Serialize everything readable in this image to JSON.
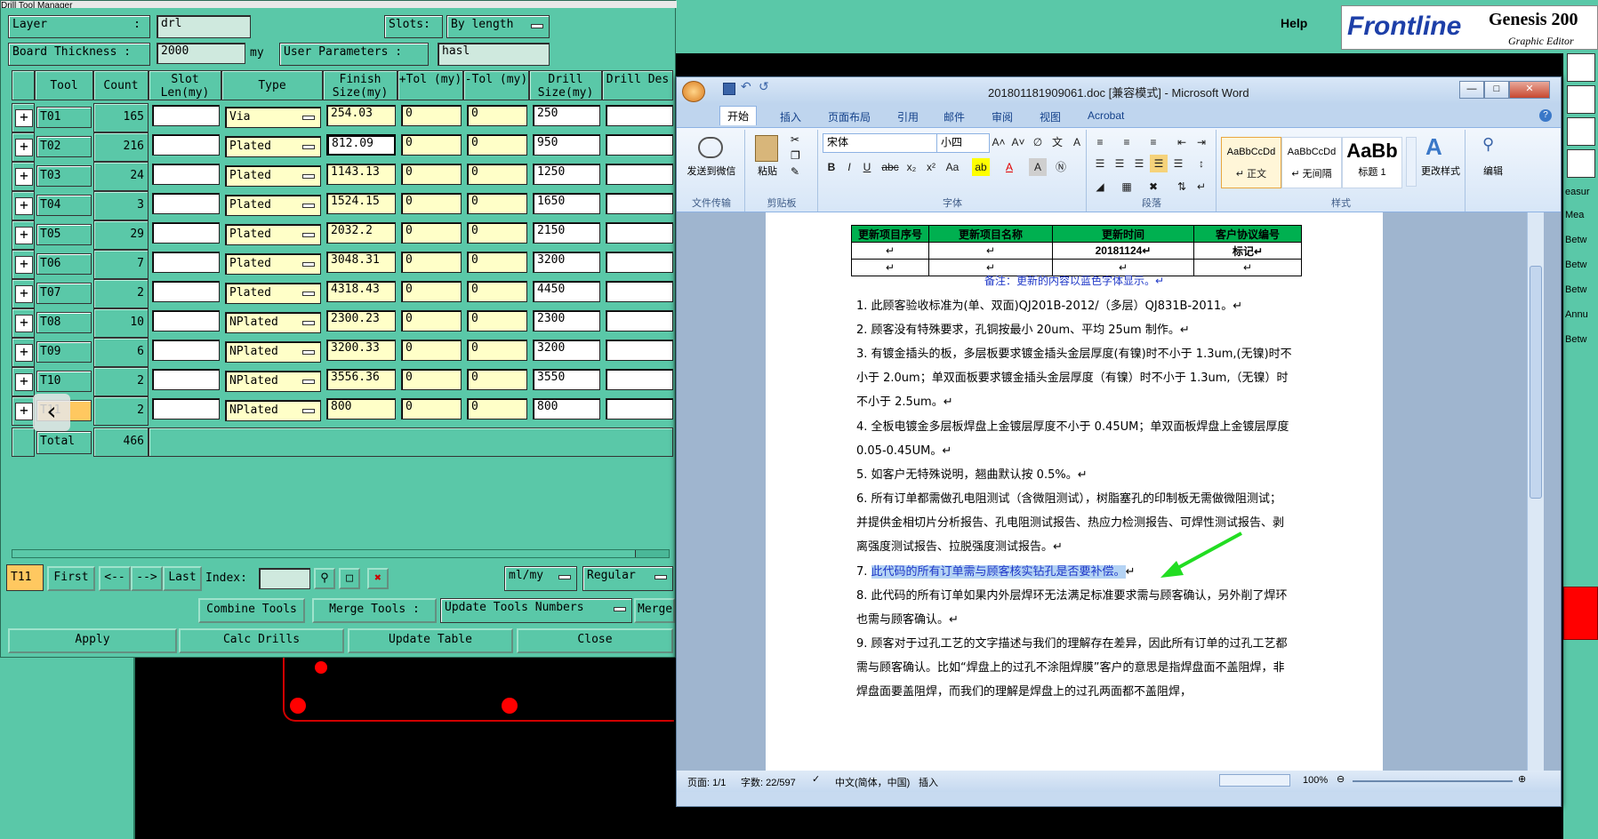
{
  "genesis": {
    "help": "Help",
    "logo_brand": "Frontline",
    "logo_product": "Genesis 200",
    "logo_sub": "Graphic Editor",
    "right_labels": [
      "easur",
      "Mea",
      "Betw",
      "Betw",
      "Betw",
      "Annu",
      "Betw"
    ]
  },
  "drill": {
    "title": "Drill Tool Manager",
    "layer_label": "Layer",
    "layer_sep": ":",
    "layer_value": "drl",
    "slots_label": "Slots:",
    "slots_value": "By length",
    "thickness_label": "Board Thickness :",
    "thickness_value": "2000",
    "thickness_unit": "my",
    "user_params_label": "User Parameters :",
    "user_params_value": "hasl",
    "headers": {
      "tool": "Tool",
      "count": "Count",
      "slot": "Slot Len(my)",
      "type": "Type",
      "finish": "Finish Size(my)",
      "ptol": "+Tol (my)",
      "ntol": "-Tol (my)",
      "drill": "Drill Size(my)",
      "des": "Drill Des"
    },
    "rows": [
      {
        "tool": "T01",
        "count": "165",
        "type": "Via",
        "finish": "254.03",
        "ptol": "0",
        "ntol": "0",
        "drill": "250"
      },
      {
        "tool": "T02",
        "count": "216",
        "type": "Plated",
        "finish": "812.09",
        "ptol": "0",
        "ntol": "0",
        "drill": "950"
      },
      {
        "tool": "T03",
        "count": "24",
        "type": "Plated",
        "finish": "1143.13",
        "ptol": "0",
        "ntol": "0",
        "drill": "1250"
      },
      {
        "tool": "T04",
        "count": "3",
        "type": "Plated",
        "finish": "1524.15",
        "ptol": "0",
        "ntol": "0",
        "drill": "1650"
      },
      {
        "tool": "T05",
        "count": "29",
        "type": "Plated",
        "finish": "2032.2",
        "ptol": "0",
        "ntol": "0",
        "drill": "2150"
      },
      {
        "tool": "T06",
        "count": "7",
        "type": "Plated",
        "finish": "3048.31",
        "ptol": "0",
        "ntol": "0",
        "drill": "3200"
      },
      {
        "tool": "T07",
        "count": "2",
        "type": "Plated",
        "finish": "4318.43",
        "ptol": "0",
        "ntol": "0",
        "drill": "4450"
      },
      {
        "tool": "T08",
        "count": "10",
        "type": "NPlated",
        "finish": "2300.23",
        "ptol": "0",
        "ntol": "0",
        "drill": "2300"
      },
      {
        "tool": "T09",
        "count": "6",
        "type": "NPlated",
        "finish": "3200.33",
        "ptol": "0",
        "ntol": "0",
        "drill": "3200"
      },
      {
        "tool": "T10",
        "count": "2",
        "type": "NPlated",
        "finish": "3556.36",
        "ptol": "0",
        "ntol": "0",
        "drill": "3550"
      },
      {
        "tool": "T11",
        "count": "2",
        "type": "NPlated",
        "finish": "800",
        "ptol": "0",
        "ntol": "0",
        "drill": "800"
      }
    ],
    "total_label": "Total",
    "total_count": "466",
    "current_tool": "T11",
    "nav": {
      "first": "First",
      "prev": "<--",
      "next": "-->",
      "last": "Last",
      "index_label": "Index:",
      "units": "ml/my",
      "mode": "Regular"
    },
    "actions1": {
      "combine": "Combine Tools",
      "merge": "Merge Tools :",
      "update_numbers": "Update Tools Numbers",
      "merge2": "Merge"
    },
    "actions2": {
      "apply": "Apply",
      "calc": "Calc Drills",
      "update_table": "Update Table",
      "close": "Close"
    }
  },
  "word": {
    "title": "201801181909061.doc [兼容模式] - Microsoft Word",
    "tabs": [
      "开始",
      "插入",
      "页面布局",
      "引用",
      "邮件",
      "审阅",
      "视图",
      "Acrobat"
    ],
    "ribbon": {
      "wechat_send": "发送到微信",
      "file_transfer": "文件传输",
      "paste": "粘贴",
      "clipboard": "剪贴板",
      "font_name": "宋体",
      "font_size": "小四",
      "font_group": "字体",
      "paragraph_group": "段落",
      "styles": [
        {
          "preview": "AaBbCcDd",
          "name": "↵ 正文"
        },
        {
          "preview": "AaBbCcDd",
          "name": "↵ 无间隔"
        },
        {
          "preview": "AaBb",
          "name": "标题 1"
        }
      ],
      "change_style": "更改样式",
      "styles_group": "样式",
      "edit": "编辑"
    },
    "table": {
      "headers": [
        "更新项目序号",
        "更新项目名称",
        "更新时间",
        "客户协议编号"
      ],
      "row1": [
        "↵",
        "↵",
        "20181124↵",
        "标记↵"
      ],
      "row2": [
        "↵",
        "↵",
        "↵",
        "↵"
      ]
    },
    "note": "备注：更新的内容以蓝色字体显示。↵",
    "items": [
      "1. 此顾客验收标准为(单、双面)QJ201B-2012/（多层）QJ831B-2011。↵",
      "2. 顾客没有特殊要求，孔铜按最小 20um、平均 25um 制作。↵",
      "3. 有镀金插头的板，多层板要求镀金插头金层厚度(有镍)时不小于 1.3um,(无镍)时不小于 2.0um；单双面板要求镀金插头金层厚度（有镍）时不小于 1.3um,（无镍）时不小于 2.5um。↵",
      "4. 全板电镀金多层板焊盘上金镀层厚度不小于 0.45UM；单双面板焊盘上金镀层厚度 0.05-0.45UM。↵",
      "5. 如客户无特殊说明，翘曲默认按 0.5%。↵",
      "6. 所有订单都需做孔电阻测试（含微阻测试），树脂塞孔的印制板无需做微阻测试；并提供金相切片分析报告、孔电阻测试报告、热应力检测报告、可焊性测试报告、剥离强度测试报告、拉脱强度测试报告。↵",
      "7. 此代码的所有订单需与顾客核实钻孔是否要补偿。↵",
      "8. 此代码的所有订单如果内外层焊环无法满足标准要求需与顾客确认，另外削了焊环也需与顾客确认。↵",
      "9. 顾客对于过孔工艺的文字描述与我们的理解存在差异，因此所有订单的过孔工艺都需与顾客确认。比如“焊盘上的过孔不涂阻焊膜”客户的意思是指焊盘面不盖阻焊，非焊盘面要盖阻焊，而我们的理解是焊盘上的过孔两面都不盖阻焊，"
    ],
    "item7_prefix": "7. ",
    "item7_text": "此代码的所有订单需与顾客核实钻孔是否要补偿。",
    "item7_mark": "↵",
    "status": {
      "page": "页面: 1/1",
      "words": "字数: 22/597",
      "lang": "中文(简体，中国)",
      "mode": "插入",
      "zoom": "100%"
    }
  },
  "colors": {
    "genesis_bg": "#5ac8a8",
    "yellow_field": "#ffffc8",
    "table_green": "#00b050",
    "highlight_text": "#1f38c8",
    "arrow": "#22dd22"
  }
}
